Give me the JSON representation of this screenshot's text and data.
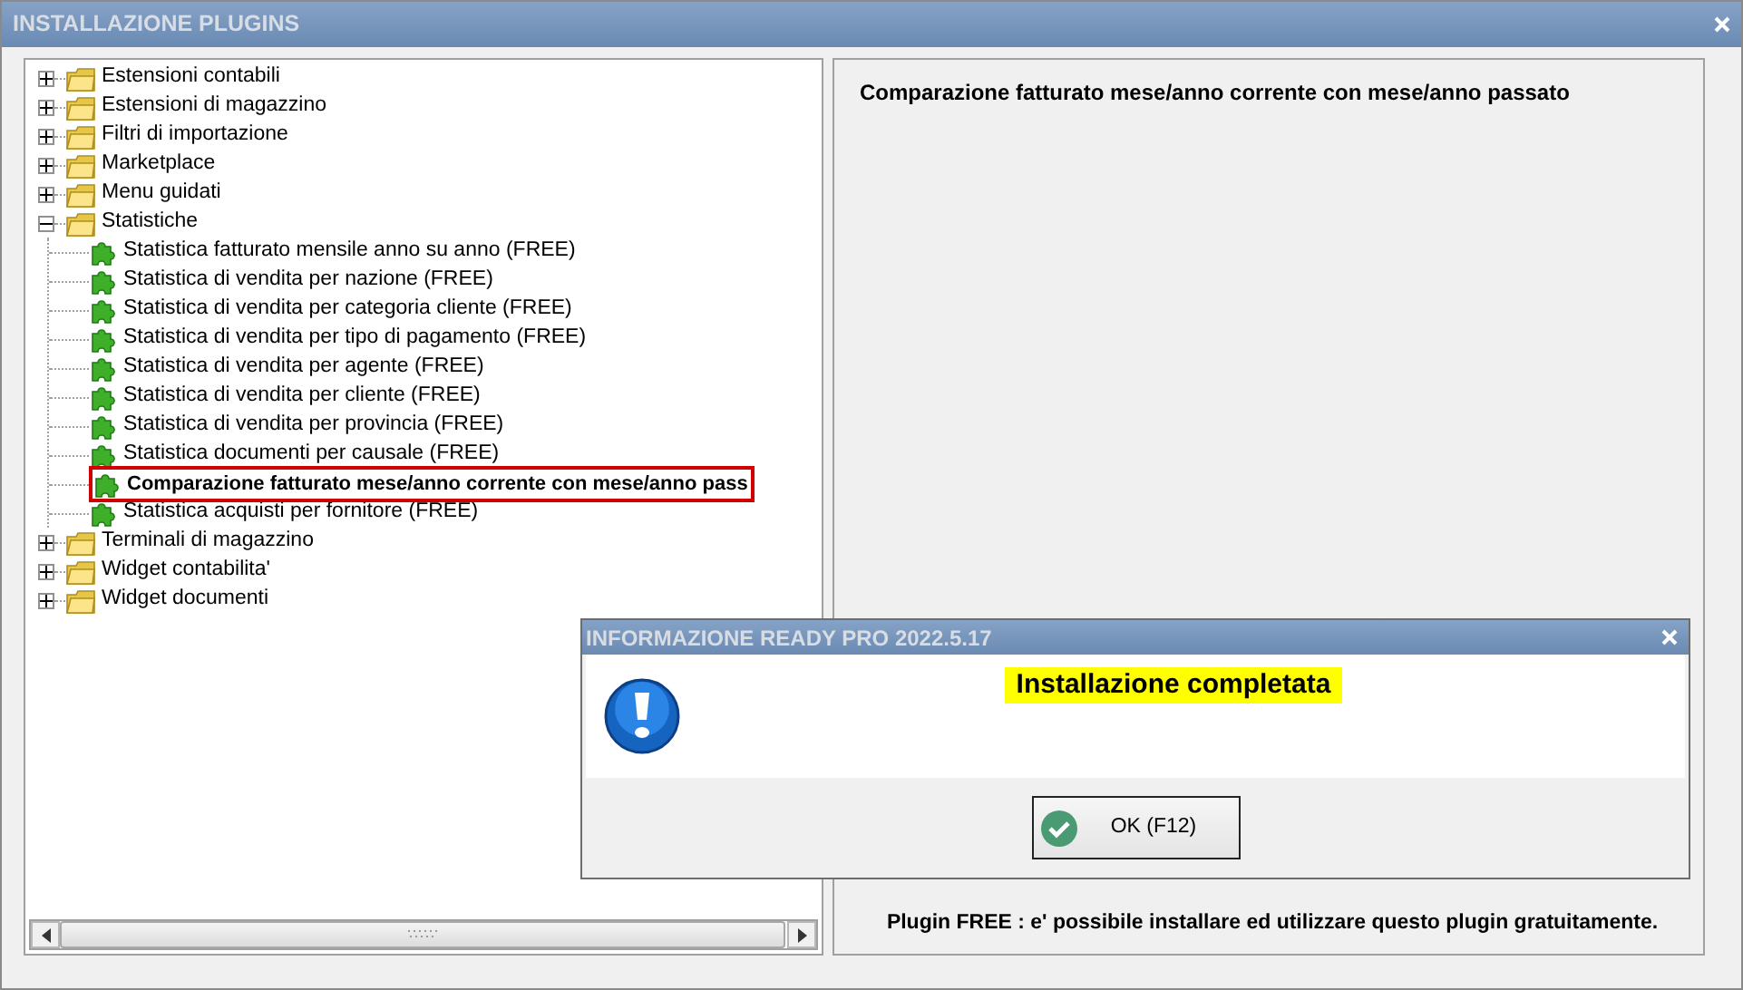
{
  "window": {
    "title": "INSTALLAZIONE PLUGINS"
  },
  "tree": [
    {
      "label": "Estensioni contabili",
      "expanded": false
    },
    {
      "label": "Estensioni di magazzino",
      "expanded": false
    },
    {
      "label": "Filtri di importazione",
      "expanded": false
    },
    {
      "label": "Marketplace",
      "expanded": false
    },
    {
      "label": "Menu guidati",
      "expanded": false
    },
    {
      "label": "Statistiche",
      "expanded": true,
      "children": [
        {
          "label": "Statistica fatturato mensile anno su anno (FREE)",
          "selected": false
        },
        {
          "label": "Statistica di vendita per nazione (FREE)",
          "selected": false
        },
        {
          "label": "Statistica di vendita per categoria cliente (FREE)",
          "selected": false
        },
        {
          "label": "Statistica di vendita per tipo di pagamento (FREE)",
          "selected": false
        },
        {
          "label": "Statistica di vendita per agente (FREE)",
          "selected": false
        },
        {
          "label": "Statistica di vendita per cliente (FREE)",
          "selected": false
        },
        {
          "label": "Statistica di vendita per provincia (FREE)",
          "selected": false
        },
        {
          "label": "Statistica documenti per causale (FREE)",
          "selected": false
        },
        {
          "label": "Comparazione fatturato mese/anno corrente con mese/anno pass",
          "selected": true
        },
        {
          "label": "Statistica acquisti per fornitore (FREE)",
          "selected": false
        }
      ]
    },
    {
      "label": "Terminali di magazzino",
      "expanded": false
    },
    {
      "label": "Widget contabilita'",
      "expanded": false
    },
    {
      "label": "Widget documenti",
      "expanded": false
    }
  ],
  "details": {
    "title": "Comparazione fatturato mese/anno corrente con mese/anno passato",
    "footer": "Plugin FREE : e' possibile installare ed utilizzare questo plugin gratuitamente."
  },
  "dialog": {
    "title": "INFORMAZIONE READY PRO 2022.5.17",
    "message": "Installazione completata",
    "button": "OK (F12)"
  }
}
